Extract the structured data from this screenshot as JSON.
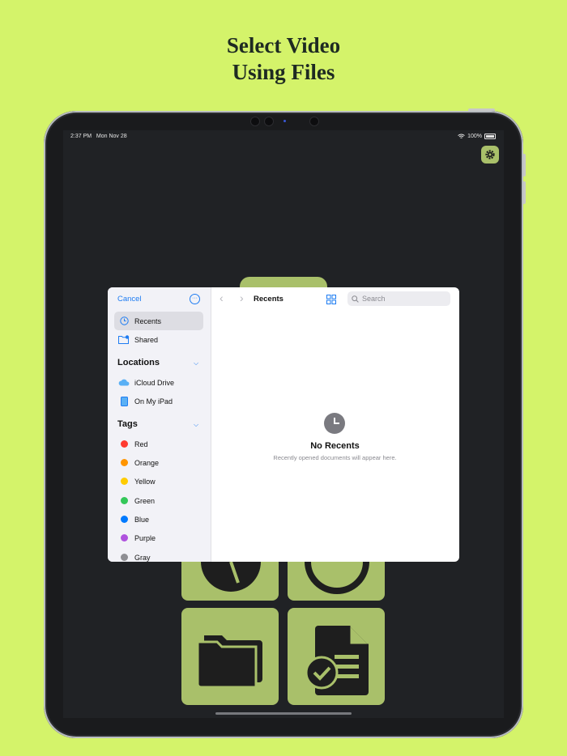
{
  "headline": {
    "line1": "Select Video",
    "line2": "Using Files"
  },
  "status_bar": {
    "time": "2:37 PM",
    "date": "Mon Nov 28",
    "battery": "100%"
  },
  "file_picker": {
    "cancel_label": "Cancel",
    "favorites": [
      {
        "label": "Recents",
        "icon": "clock-icon",
        "selected": true
      },
      {
        "label": "Shared",
        "icon": "shared-folder-icon",
        "selected": false
      }
    ],
    "locations_header": "Locations",
    "locations": [
      {
        "label": "iCloud Drive",
        "icon": "cloud-icon"
      },
      {
        "label": "On My iPad",
        "icon": "ipad-icon"
      }
    ],
    "tags_header": "Tags",
    "tags": [
      {
        "label": "Red",
        "color": "#ff3b30"
      },
      {
        "label": "Orange",
        "color": "#ff9500"
      },
      {
        "label": "Yellow",
        "color": "#ffcc00"
      },
      {
        "label": "Green",
        "color": "#34c759"
      },
      {
        "label": "Blue",
        "color": "#007aff"
      },
      {
        "label": "Purple",
        "color": "#af52de"
      },
      {
        "label": "Gray",
        "color": "#8e8e93"
      }
    ],
    "title": "Recents",
    "search_placeholder": "Search",
    "empty_title": "No Recents",
    "empty_subtitle": "Recently opened documents will appear here."
  },
  "colors": {
    "background": "#d4f36a",
    "tile": "#a9c06a",
    "accent": "#1e7cf2"
  }
}
